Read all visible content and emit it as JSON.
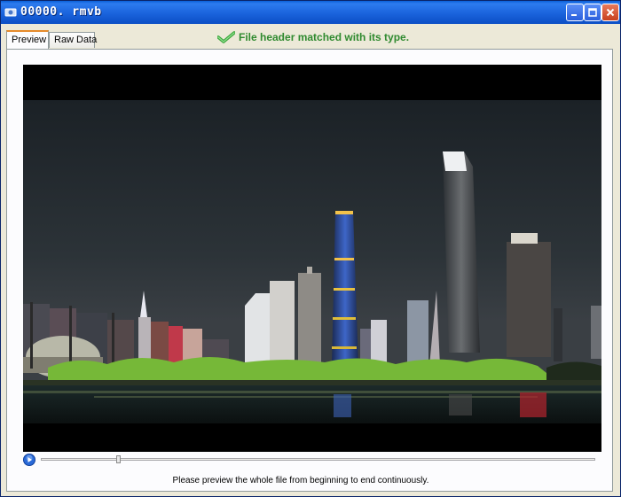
{
  "window": {
    "title": "00000. rmvb",
    "icons": {
      "app": "app-icon",
      "minimize": "minimize-icon",
      "maximize": "maximize-icon",
      "close": "close-icon"
    }
  },
  "tabs": [
    {
      "label": "Preview",
      "active": true
    },
    {
      "label": "Raw Data",
      "active": false
    }
  ],
  "status": {
    "icon": "green-checkmark-icon",
    "text": "File header matched with its type."
  },
  "player": {
    "play_icon": "play-icon",
    "progress_fraction": 0.14
  },
  "hint": "Please preview the whole file from beginning to end continuously.",
  "colors": {
    "titlebar": "#0c4fc5",
    "status_text": "#2f8a2f",
    "active_tab_accent": "#e68b2c",
    "video_background": "#000000"
  }
}
